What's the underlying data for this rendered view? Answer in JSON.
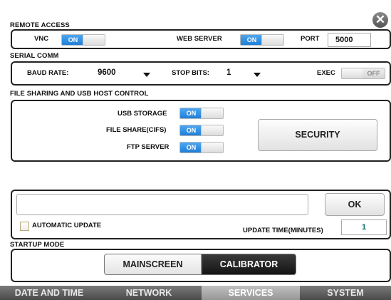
{
  "remote_access": {
    "title": "REMOTE ACCESS",
    "vnc_label": "VNC",
    "vnc_state": "ON",
    "web_server_label": "WEB SERVER",
    "web_server_state": "ON",
    "port_label": "PORT",
    "port_value": "5000"
  },
  "serial_comm": {
    "title": "SERIAL COMM",
    "baud_rate_label": "BAUD RATE:",
    "baud_rate_value": "9600",
    "stop_bits_label": "STOP BITS:",
    "stop_bits_value": "1",
    "exec_label": "EXEC",
    "exec_state": "OFF"
  },
  "file_sharing": {
    "title": "FILE SHARING AND USB HOST CONTROL",
    "usb_storage_label": "USB STORAGE",
    "usb_storage_state": "ON",
    "file_share_label": "FILE SHARE(CIFS)",
    "file_share_state": "ON",
    "ftp_server_label": "FTP SERVER",
    "ftp_server_state": "ON",
    "security_button": "SECURITY"
  },
  "update": {
    "url_value": "",
    "ok_button": "OK",
    "automatic_update_label": "AUTOMATIC UPDATE",
    "update_time_label": "UPDATE TIME(MINUTES)",
    "update_time_value": "1"
  },
  "startup_mode": {
    "title": "STARTUP MODE",
    "options": [
      "MAINSCREEN",
      "CALIBRATOR"
    ],
    "selected": "CALIBRATOR"
  },
  "tabs": [
    "DATE AND TIME",
    "NETWORK",
    "SERVICES",
    "SYSTEM"
  ],
  "active_tab": "SERVICES",
  "colors": {
    "toggle_on": "#1f7fd8",
    "selected_segment": "#1e1e1e",
    "tab_bar": "#5a5a5a",
    "active_tab": "#a9a9a9",
    "value_teal": "#0a6b6b"
  }
}
